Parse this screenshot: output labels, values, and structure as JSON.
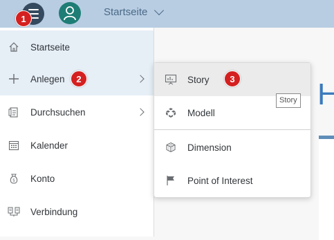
{
  "header": {
    "title": "Startseite",
    "menu_icon": "hamburger-menu-icon",
    "avatar_icon": "user-avatar-icon"
  },
  "sidebar": {
    "items": [
      {
        "label": "Startseite",
        "icon": "home-icon"
      },
      {
        "label": "Anlegen",
        "icon": "plus-icon"
      },
      {
        "label": "Durchsuchen",
        "icon": "browse-icon"
      },
      {
        "label": "Kalender",
        "icon": "calendar-icon"
      },
      {
        "label": "Konto",
        "icon": "money-bag-icon"
      },
      {
        "label": "Verbindung",
        "icon": "connection-icon"
      }
    ]
  },
  "submenu": {
    "items": [
      {
        "label": "Story",
        "icon": "presentation-icon"
      },
      {
        "label": "Modell",
        "icon": "cubes-icon"
      },
      {
        "label": "Dimension",
        "icon": "dimension-cube-icon"
      },
      {
        "label": "Point of Interest",
        "icon": "flag-icon"
      }
    ]
  },
  "tooltip": {
    "text": "Story"
  },
  "page": {
    "heading_fragment": "H"
  },
  "badges": {
    "one": "1",
    "two": "2",
    "three": "3"
  },
  "colors": {
    "topbar": "#b8cde2",
    "shell_dark": "#354a5f",
    "avatar": "#1e7d75",
    "badge": "#d42020",
    "accent": "#3a7bbd"
  }
}
